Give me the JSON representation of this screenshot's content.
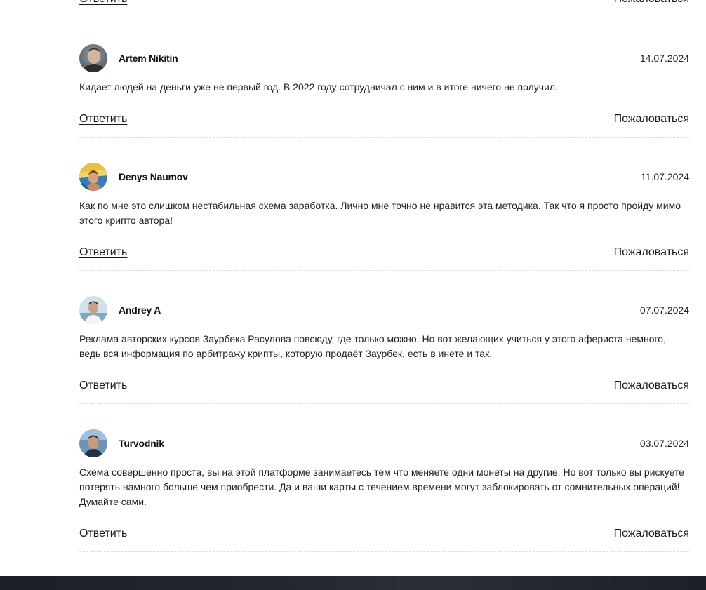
{
  "top": {
    "reply_label": "Ответить",
    "report_label": "Пожаловаться"
  },
  "comments": [
    {
      "author": "Artem Nikitin",
      "date": "14.07.2024",
      "text": "Кидает людей на деньги уже не первый год. В 2022 году сотрудничал с ним и в итоге ничего не получил.",
      "reply_label": "Ответить",
      "report_label": "Пожаловаться"
    },
    {
      "author": "Denys Naumov",
      "date": "11.07.2024",
      "text": "Как по мне это слишком нестабильная схема заработка. Лично мне точно не нравится эта методика. Так что я просто пройду мимо этого крипто автора!",
      "reply_label": "Ответить",
      "report_label": "Пожаловаться"
    },
    {
      "author": "Andrey A",
      "date": "07.07.2024",
      "text": "Реклама авторских курсов Заурбека Расулова повсюду, где только можно. Но вот желающих учиться у этого афериста немного, ведь вся информация по арбитражу крипты, которую продаёт Заурбек, есть в инете и так.",
      "reply_label": "Ответить",
      "report_label": "Пожаловаться"
    },
    {
      "author": "Turvodnik",
      "date": "03.07.2024",
      "text": "Схема совершенно проста, вы на этой платформе занимаетесь тем что меняете одни монеты на другие. Но вот только вы рискуете потерять намного больше чем приобрести. Да и ваши карты с течением времени могут заблокировать от сомнительных операций! Думайте сами.",
      "reply_label": "Ответить",
      "report_label": "Пожаловаться"
    }
  ]
}
